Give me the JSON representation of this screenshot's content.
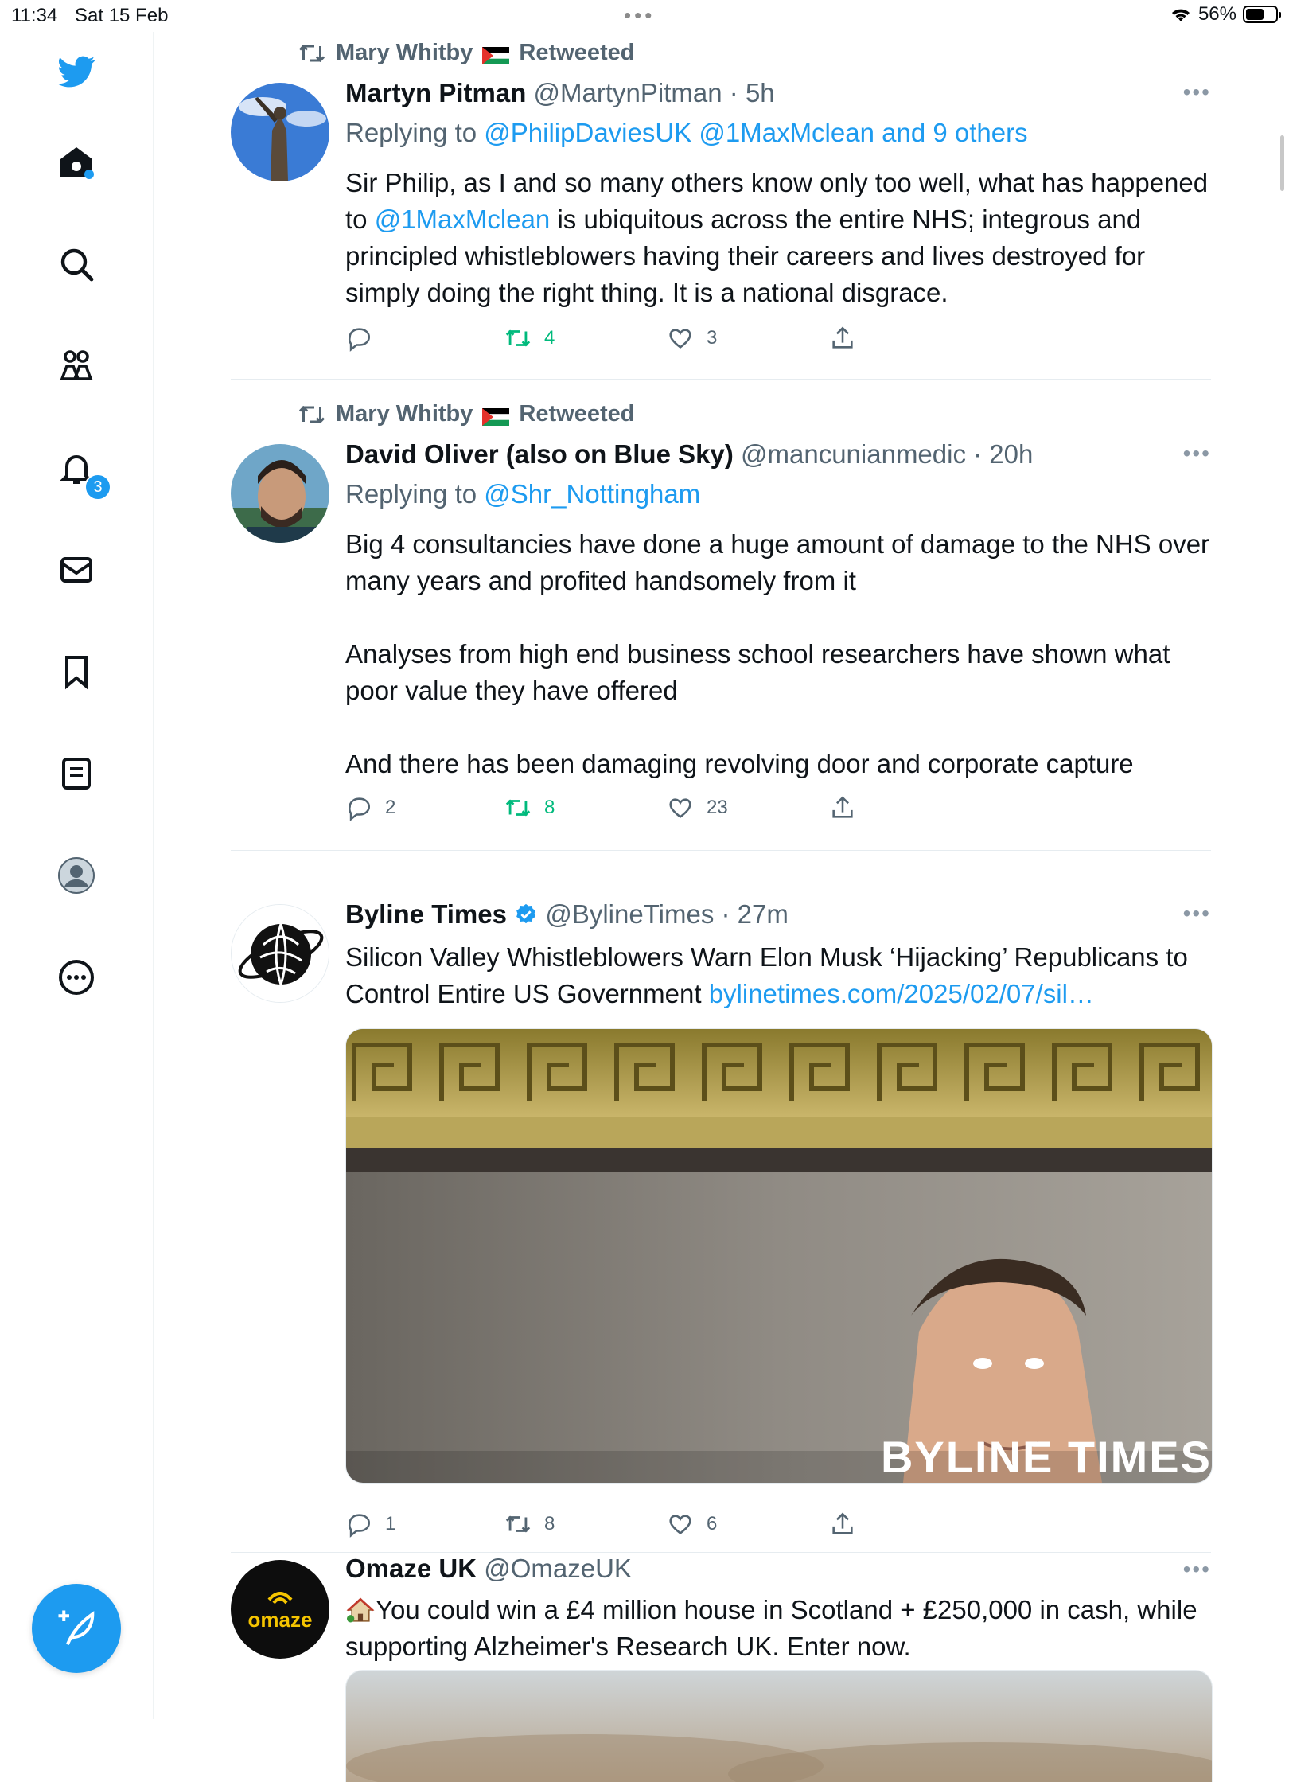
{
  "status_bar": {
    "time": "11:34",
    "date": "Sat 15 Feb",
    "battery": "56%",
    "battery_level": 0.56
  },
  "sidebar": {
    "items": [
      {
        "name": "home",
        "icon": "home-icon"
      },
      {
        "name": "explore",
        "icon": "search-icon"
      },
      {
        "name": "communities",
        "icon": "communities-icon"
      },
      {
        "name": "notifications",
        "icon": "bell-icon",
        "badge": "3"
      },
      {
        "name": "messages",
        "icon": "envelope-icon"
      },
      {
        "name": "bookmarks",
        "icon": "bookmark-icon"
      },
      {
        "name": "lists",
        "icon": "list-icon"
      },
      {
        "name": "profile",
        "icon": "avatar-icon"
      },
      {
        "name": "more",
        "icon": "more-circle-icon"
      }
    ],
    "compose_icon": "compose-feather-icon"
  },
  "tweets": [
    {
      "retweeted_by": "Mary Whitby",
      "retweeted_label": "Retweeted",
      "name": "Martyn Pitman",
      "handle": "@MartynPitman",
      "time": "· 5h",
      "replying_label": "Replying to",
      "replying_to": "@PhilipDaviesUK @1MaxMclean and 9 others",
      "text_1": "Sir Philip, as I and so many others know only too well, what has happened to",
      "mention": "@1MaxMclean",
      "text_2": "is ubiquitous across the entire NHS; integrous and principled whistleblowers having their careers and lives destroyed for simply doing the right thing. It is a national disgrace.",
      "replies": "",
      "retweets": "4",
      "likes": "3"
    },
    {
      "retweeted_by": "Mary Whitby",
      "retweeted_label": "Retweeted",
      "name": "David Oliver (also on Blue Sky)",
      "handle": "@mancunianmedic",
      "time": "· 20h",
      "replying_label": "Replying to",
      "replying_to": "@Shr_Nottingham",
      "para_1": "Big 4 consultancies have done a huge amount of damage to the NHS over many years and profited handsomely from it",
      "para_2": "Analyses from high end business school researchers have shown what poor value they have offered",
      "para_3": "And there has been  damaging revolving door and corporate capture",
      "replies": "2",
      "retweets": "8",
      "likes": "23"
    },
    {
      "name": "Byline Times",
      "verified": true,
      "handle": "@BylineTimes",
      "time": "· 27m",
      "text": "Silicon Valley Whistleblowers Warn Elon Musk ‘Hijacking’ Republicans to Control Entire US Government",
      "link": "bylinetimes.com/2025/02/07/sil…",
      "watermark": "BYLINE TIMES",
      "replies": "1",
      "retweets": "8",
      "likes": "6"
    },
    {
      "name": "Omaze UK",
      "handle": "@OmazeUK",
      "avatar_text": "omaze",
      "text": "You could win a £4 million house in Scotland + £250,000 in cash, while supporting Alzheimer's Research UK. Enter now."
    }
  ]
}
